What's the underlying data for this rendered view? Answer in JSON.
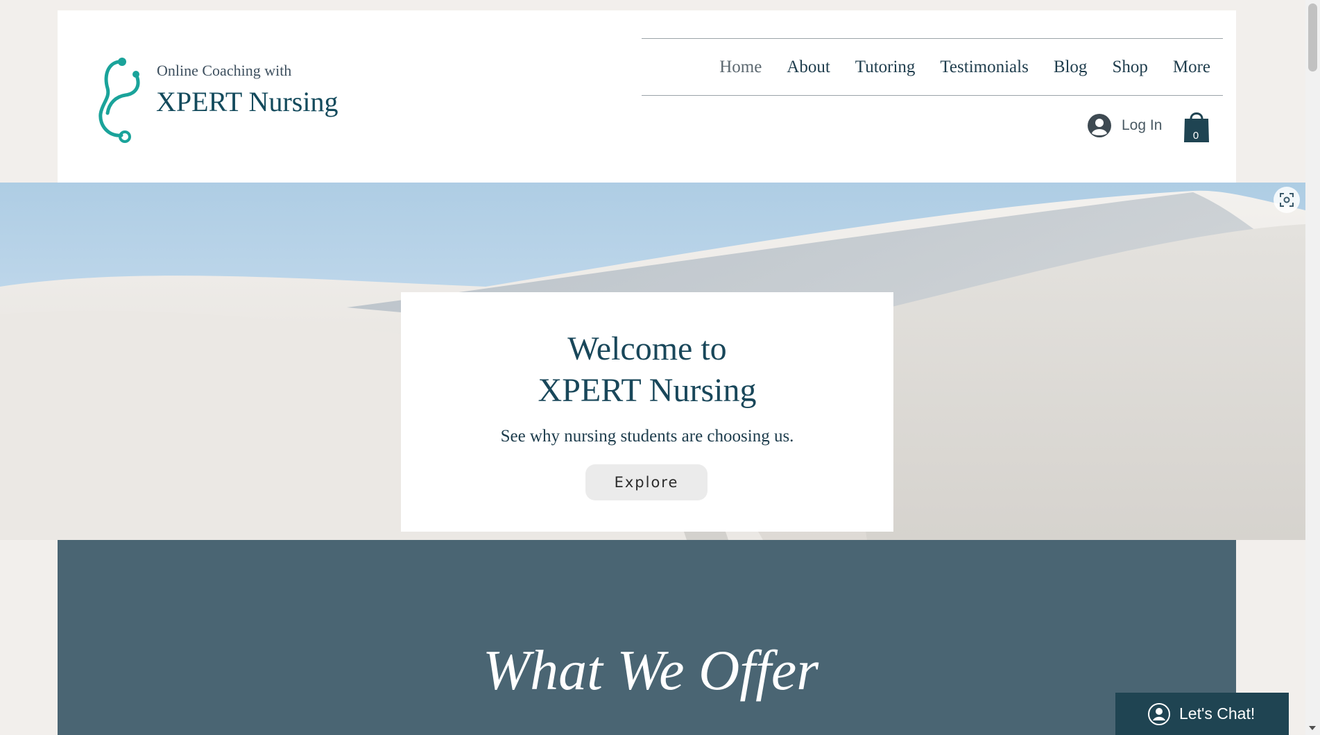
{
  "header": {
    "brand_top": "Online Coaching with",
    "brand_main": "XPERT Nursing",
    "logo_icon": "stethoscope-icon",
    "nav": [
      {
        "label": "Home",
        "active": true
      },
      {
        "label": "About"
      },
      {
        "label": "Tutoring"
      },
      {
        "label": "Testimonials"
      },
      {
        "label": "Blog"
      },
      {
        "label": "Shop"
      },
      {
        "label": "More"
      }
    ],
    "login_label": "Log In",
    "cart_count": "0",
    "accent_color": "#1aa39a",
    "brand_color": "#134a5c"
  },
  "hero": {
    "title_line1": "Welcome to",
    "title_line2": "XPERT Nursing",
    "subtitle": "See why nursing students are choosing us.",
    "button_label": "Explore"
  },
  "offer": {
    "title": "What We Offer",
    "background": "#4a6573"
  },
  "chat": {
    "label": "Let's Chat!"
  }
}
